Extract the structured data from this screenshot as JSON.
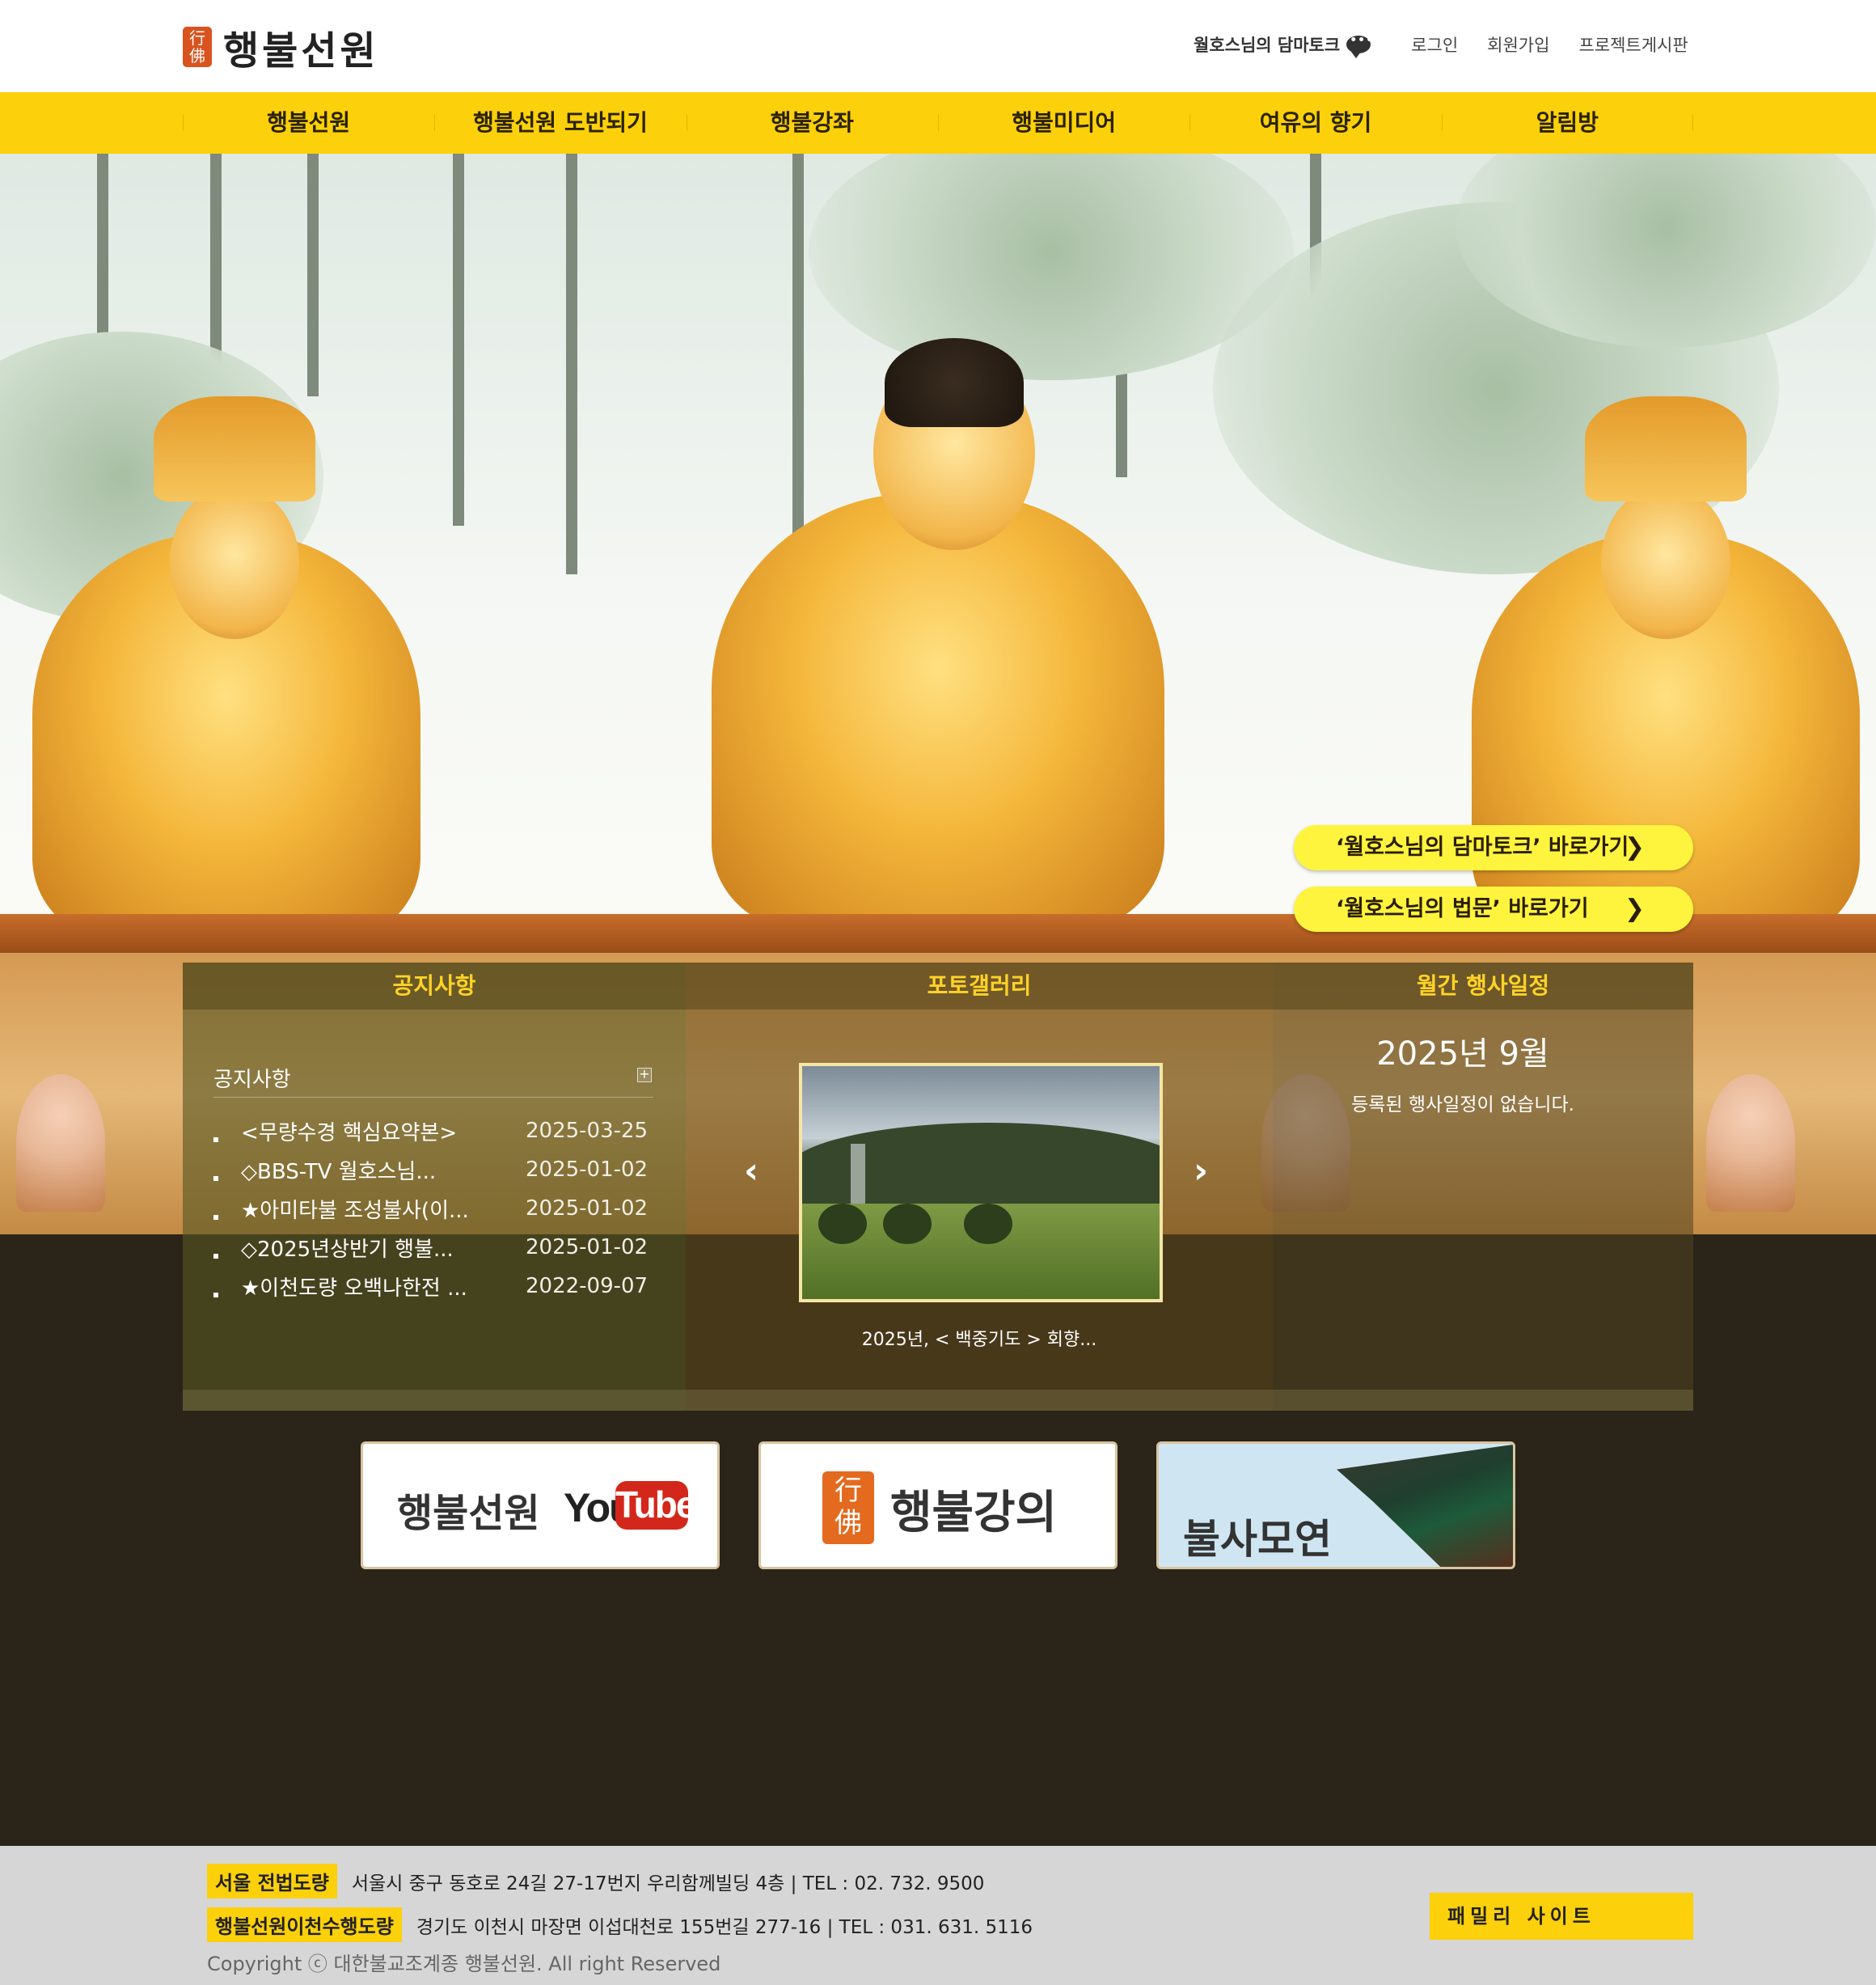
{
  "header": {
    "logo_mark": "行佛",
    "logo_text": "행불선원",
    "dharma_talk": "월호스님의 담마토크",
    "login": "로그인",
    "signup": "회원가입",
    "project_board": "프로젝트게시판"
  },
  "nav": {
    "items": [
      "행불선원",
      "행불선원 도반되기",
      "행불강좌",
      "행불미디어",
      "여유의 향기",
      "알림방"
    ]
  },
  "hero": {
    "cta_dharma_talk": "‘월호스님의 담마토크’ 바로가기",
    "cta_sermon": "‘월호스님의 법문’ 바로가기"
  },
  "panel": {
    "notice": {
      "header": "공지사항",
      "title": "공지사항",
      "plus": "+",
      "items": [
        {
          "title": "<무량수경 핵심요약본>",
          "date": "2025-03-25"
        },
        {
          "title": "◇BBS-TV 월호스님...",
          "date": "2025-01-02"
        },
        {
          "title": "★아미타불 조성불사(이...",
          "date": "2025-01-02"
        },
        {
          "title": "◇2025년상반기 행불...",
          "date": "2025-01-02"
        },
        {
          "title": "★이천도량 오백나한전 ...",
          "date": "2022-09-07"
        }
      ]
    },
    "gallery": {
      "header": "포토갤러리",
      "caption": "2025년, < 백중기도 > 회향...",
      "prev": "‹",
      "next": "›"
    },
    "events": {
      "header": "월간 행사일정",
      "month": "2025년 9월",
      "empty": "등록된 행사일정이 없습니다."
    }
  },
  "banners": {
    "youtube_label": "행불선원",
    "youtube_you": "You",
    "youtube_tube": "Tube",
    "lecture_mark": "行佛",
    "lecture_label": "행불강의",
    "temple_label": "불사모연"
  },
  "footer": {
    "seoul_tag": "서울 전법도량",
    "seoul_addr": "서울시 중구 동호로 24길 27-17번지 우리함께빌딩 4층 | TEL : 02. 732. 9500",
    "icheon_tag": "행불선원이천수행도량",
    "icheon_addr": "경기도 이천시 마장면 이섭대천로 155번길 277-16 | TEL : 031. 631. 5116",
    "copyright": "Copyright ⓒ 대한불교조계종 행불선원. All right Reserved",
    "family_site": "패밀리 사이트"
  },
  "colors": {
    "accent": "#fcd00a",
    "dark_bg": "#2a2419",
    "footer_bg": "#d6d6d6",
    "panel_header_text": "#ffd327"
  }
}
